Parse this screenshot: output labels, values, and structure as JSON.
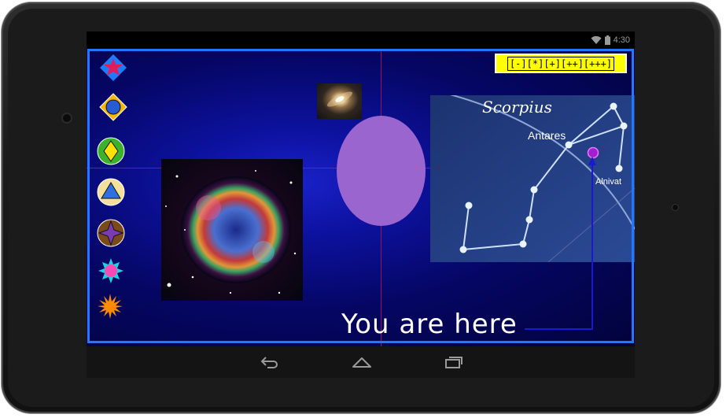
{
  "status_bar": {
    "time": "4:30",
    "icons": [
      "wifi-icon",
      "battery-icon"
    ]
  },
  "toolbar": {
    "shapes": [
      {
        "name": "red-star-diamond-icon",
        "colors": [
          "#1e7bff",
          "#e5195b"
        ]
      },
      {
        "name": "blue-circle-diamond-icon",
        "colors": [
          "#f5b800",
          "#2a5bd7"
        ]
      },
      {
        "name": "yellow-diamond-circle-icon",
        "colors": [
          "#3bb12c",
          "#ffe100"
        ]
      },
      {
        "name": "blue-triangle-circle-icon",
        "colors": [
          "#f3e09a",
          "#2f6fe0"
        ]
      },
      {
        "name": "purple-star-circle-icon",
        "colors": [
          "#7a4a1a",
          "#7a3bb0"
        ]
      },
      {
        "name": "pink-circle-star-icon",
        "colors": [
          "#19d6e0",
          "#ff49b4"
        ]
      },
      {
        "name": "orange-sun-icon",
        "colors": [
          "#ff8c00"
        ]
      }
    ]
  },
  "zoom_controls": {
    "buttons": [
      "[-]",
      "[*]",
      "[+]",
      "[++]",
      "[+++]"
    ]
  },
  "constellation": {
    "title": "Scorpius",
    "star_labels": [
      "Antares",
      "Alnivat"
    ]
  },
  "overlay": {
    "label": "You are here"
  },
  "nav_bar": {
    "buttons": [
      "back-icon",
      "home-icon",
      "recent-apps-icon"
    ]
  },
  "colors": {
    "frame_border": "#2277ff",
    "crosshair": "#c0194a",
    "oval": "#9a65cf",
    "pointer_line": "#1a1acc",
    "zoom_bg": "#ffff00"
  }
}
